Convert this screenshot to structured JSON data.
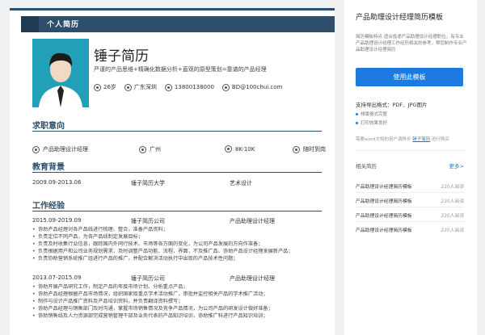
{
  "resume": {
    "header_label": "个人简历",
    "name": "锤子简历",
    "tagline": "严谨的产品思维+精确化数据分析+直观的原型策划=靠谱的产品经理",
    "info": {
      "age": "26岁",
      "location": "广东深圳",
      "phone": "13800138000",
      "email": "BD@100chui.com"
    },
    "intent": {
      "title": "求职意向",
      "position": "产品助理设计经理",
      "city": "广州",
      "salary": "8K-10K",
      "availability": "随时到岗"
    },
    "education": {
      "title": "教育背景",
      "period": "2009.09-2013.06",
      "school": "锤子简历大学",
      "major": "艺术设计"
    },
    "work": {
      "title": "工作经验",
      "jobs": [
        {
          "period": "2015.09-2019.09",
          "company": "锤子简历公司",
          "role": "产品助理设计经理",
          "bullets": [
            "协助产品经理对各产品线进行梳理、整合，准备产品资料；",
            "负责定位不同产品，为各产品线制定发展目标；",
            "负责及时收集行业信息，跟踪国内外同行技术、市场等各方面的变化，为公司产品发展的方向作准备；",
            "负责根据用户和公司业务规划需求，及时调整产品功能、流程、界面，不及推广品、协助产品设计经理发展新产品；",
            "负责协助营销系统推广组进行产品的推广，并配合解决活动执行中出现的产品技术性问题；"
          ]
        },
        {
          "period": "2013.07-2015.09",
          "company": "锤子简历公司",
          "role": "产品助理设计经理",
          "bullets": [
            "协助开展产品研究工作，制定产品的年度市场计划、分析重点产品；",
            "协助产品经理根据产品市场情况，组织国家级重点学术活动推广，审批并监控相关产品的学术推广活动；",
            "制作与设计产品推广资料及产品培训资料，并负责翻译资料撰写；",
            "协助产品经理与销售部门及时沟通，掌握市场销售情况及竞争产品情况，为公司产品的研发设计做好准备；",
            "协助销售线及人力资源部完成营销管理干部及业务代表的产品知识培训，协助推广科进行产品知识培训；"
          ]
        }
      ]
    }
  },
  "sidebar": {
    "title": "产品助理设计经理简历模板",
    "description": "简历模板特点 适合投递产品助理设计经理职位，有专业产品助理设计经理工作经历相关的参考，帮您制作专业产品助理设计经理简历",
    "use_button": "使用此模板",
    "formats": "支持导出格式：PDF、JPG图片",
    "features": [
      "排版格式完整",
      "打印效果良好"
    ],
    "howto_prefix": "需要word文档的用户请移步",
    "howto_link": "锤子简历",
    "howto_suffix": "进行购买",
    "related_title": "相关简历",
    "more": "更多>",
    "related": [
      {
        "title": "产品助理设计经理简历模板",
        "views": "220人阅读"
      },
      {
        "title": "产品助理设计经理简历模板",
        "views": "220人阅读"
      },
      {
        "title": "产品助理设计经理简历模板",
        "views": "220人阅读"
      },
      {
        "title": "产品助理设计经理简历模板",
        "views": "220人阅读"
      }
    ]
  }
}
